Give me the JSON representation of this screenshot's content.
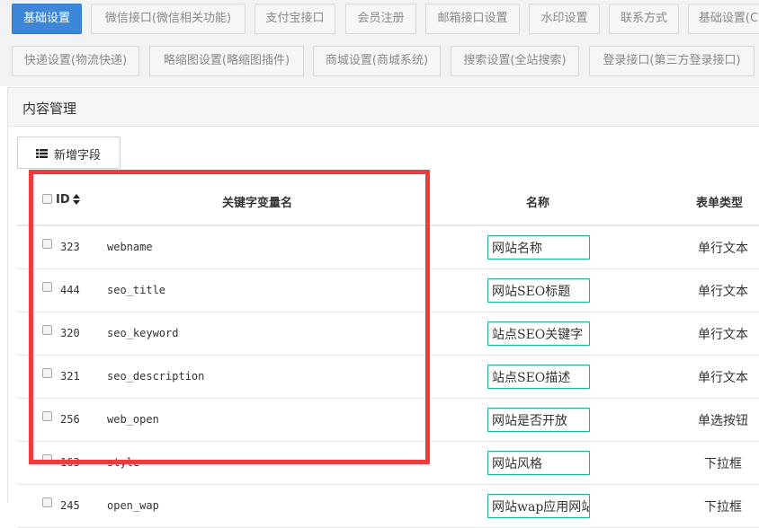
{
  "tabs": [
    {
      "label": "基础设置",
      "active": true
    },
    {
      "label": "微信接口(微信相关功能)",
      "active": false
    },
    {
      "label": "支付宝接口",
      "active": false
    },
    {
      "label": "会员注册",
      "active": false
    },
    {
      "label": "邮箱接口设置",
      "active": false
    },
    {
      "label": "水印设置",
      "active": false
    },
    {
      "label": "联系方式",
      "active": false
    },
    {
      "label": "基础设置(C",
      "active": false
    },
    {
      "label": "快递设置(物流快递)",
      "active": false
    },
    {
      "label": "略缩图设置(略缩图插件)",
      "active": false
    },
    {
      "label": "商城设置(商城系统)",
      "active": false
    },
    {
      "label": "搜索设置(全站搜索)",
      "active": false
    },
    {
      "label": "登录接口(第三方登录接口)",
      "active": false
    }
  ],
  "panel": {
    "title": "内容管理"
  },
  "toolbar": {
    "add_field_label": "新增字段"
  },
  "table": {
    "headers": {
      "id": "ID",
      "keyword": "关键字变量名",
      "name": "名称",
      "form_type": "表单类型"
    },
    "rows": [
      {
        "id": "323",
        "keyword": "webname",
        "name": "网站名称",
        "form_type": "单行文本"
      },
      {
        "id": "444",
        "keyword": "seo_title",
        "name": "网站SEO标题",
        "form_type": "单行文本"
      },
      {
        "id": "320",
        "keyword": "seo_keyword",
        "name": "站点SEO关键字",
        "form_type": "单行文本"
      },
      {
        "id": "321",
        "keyword": "seo_description",
        "name": "站点SEO描述",
        "form_type": "单行文本"
      },
      {
        "id": "256",
        "keyword": "web_open",
        "name": "网站是否开放",
        "form_type": "单选按钮"
      },
      {
        "id": "163",
        "keyword": "style",
        "name": "网站风格",
        "form_type": "下拉框"
      },
      {
        "id": "245",
        "keyword": "open_wap",
        "name": "网站wap应用网站",
        "form_type": "下拉框"
      }
    ]
  },
  "colors": {
    "accent": "#3c87d7",
    "input_border": "#1ab394",
    "highlight": "#ef3b3b"
  }
}
